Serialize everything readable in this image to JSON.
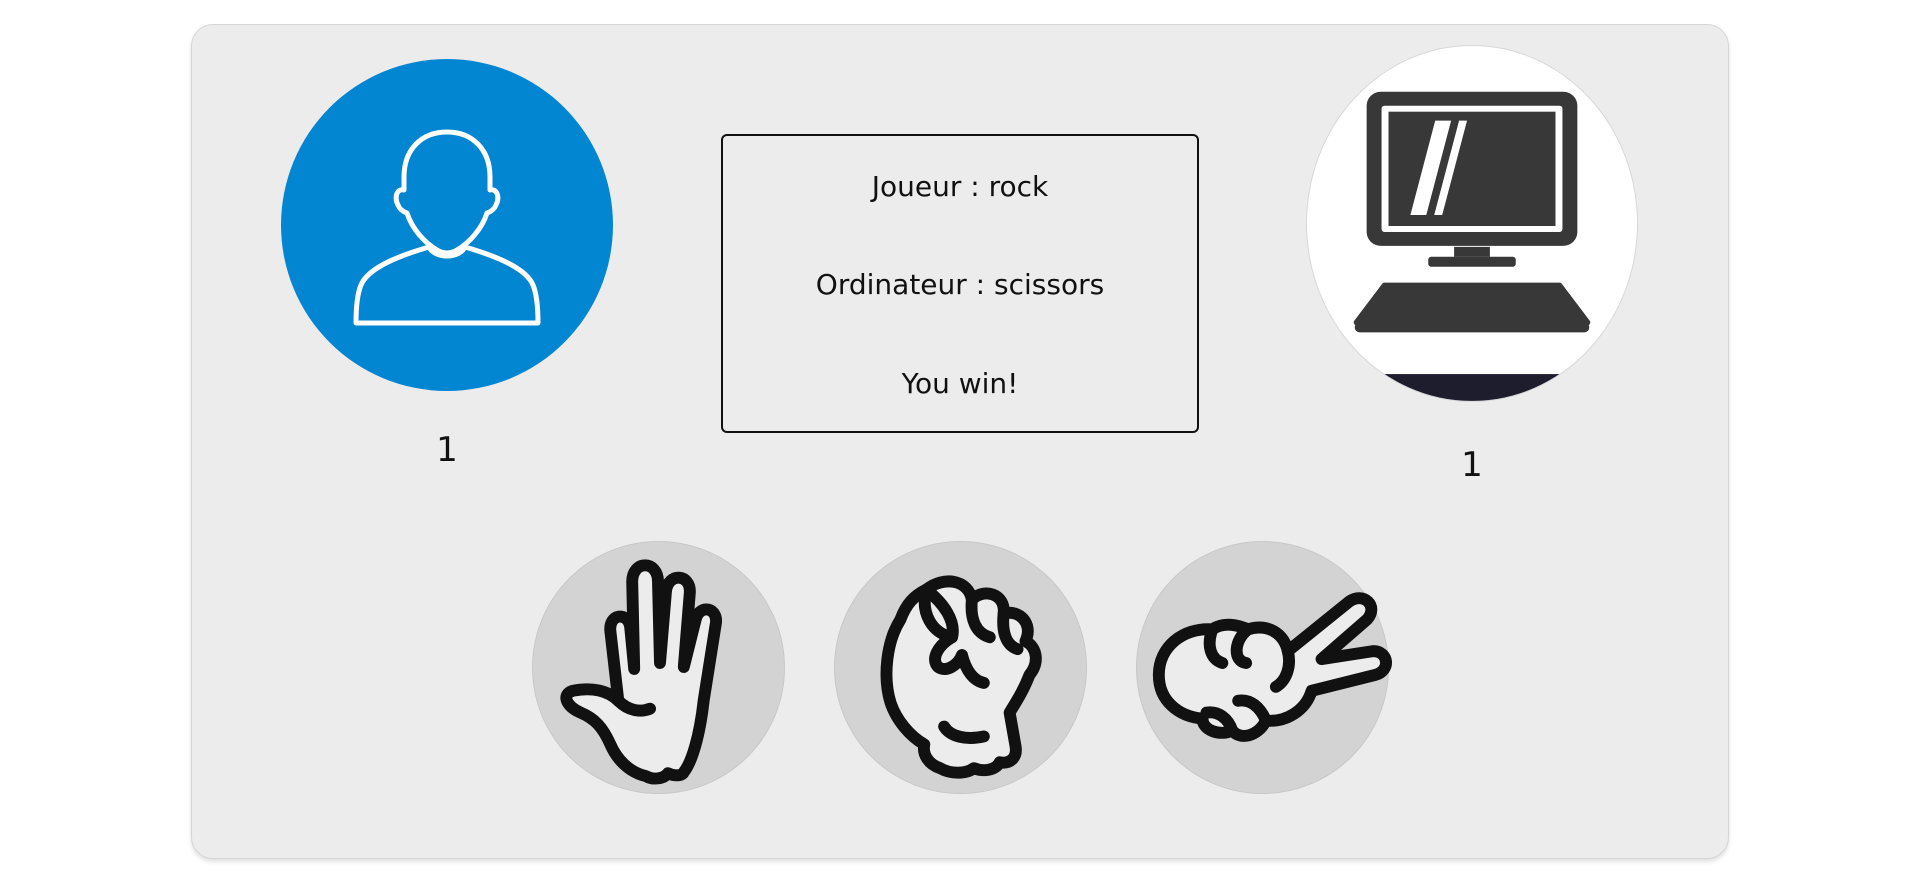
{
  "game": {
    "player_score": "1",
    "computer_score": "1"
  },
  "result": {
    "player_line": "Joueur : rock",
    "computer_line": "Ordinateur : scissors",
    "outcome": "You win!"
  },
  "icons": {
    "player": "user-silhouette-icon",
    "computer": "desktop-computer-icon",
    "choices": [
      "paper-hand-icon",
      "rock-fist-icon",
      "scissors-hand-icon"
    ]
  },
  "colors": {
    "player_avatar_bg": "#0386d2",
    "board_bg": "#ececec",
    "choice_bg": "#d3d3d3"
  }
}
